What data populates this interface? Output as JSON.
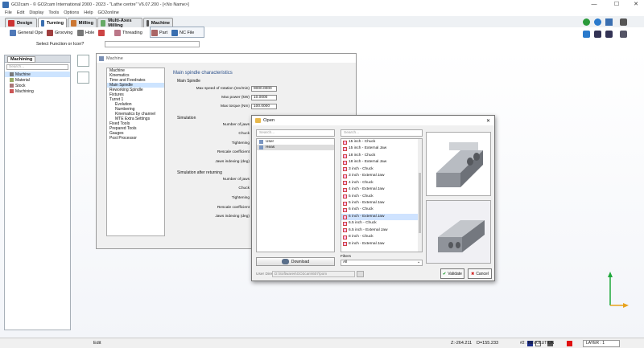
{
  "window": {
    "title": "GO2cam - © GO2cam International 2000 - 2023 - \"Lathe centre\" V6.07.200 - [<No Name>]",
    "min": "—",
    "max": "☐",
    "close": "✕"
  },
  "menu": [
    "File",
    "Edit",
    "Display",
    "Tools",
    "Options",
    "Help",
    "GO2online"
  ],
  "tabs": [
    {
      "label": "Design",
      "color": "#c33"
    },
    {
      "label": "Turning",
      "color": "#3a6fb0"
    },
    {
      "label": "Milling",
      "color": "#c73"
    },
    {
      "label": "Multi-Axes Milling",
      "color": "#6a6"
    },
    {
      "label": "Machine",
      "color": "#555"
    }
  ],
  "ribbon": {
    "general": "General Ope",
    "grooving": "Grooving",
    "hole": "Hole",
    "threading": "Threading",
    "part": "Part",
    "ncfile": "NC File"
  },
  "search_label": "Select Function or Icon?",
  "left_panel": {
    "tab": "Machining",
    "search_placeholder": "Search...",
    "items": [
      "Machine",
      "Material",
      "Stock",
      "Machining"
    ]
  },
  "machine_dialog": {
    "title": "Machine",
    "nav": [
      "Machine",
      "Kinematics",
      "Time and Feedrates",
      "Main Spindle",
      "Reworking Spindle",
      "Fixtures",
      "Turret 1",
      "Evolution",
      "Numbering",
      "Kinematics by channel",
      "MTE Extra Settings",
      "Fixed Tools",
      "Prepared Tools",
      "Gauges",
      "Post Processor"
    ],
    "heading": "Main spindle characteristics",
    "main_spindle": "Main Spindle",
    "max_speed_label": "Max speed of rotation (rev/min)",
    "max_speed": "9000.0000",
    "max_power_label": "Max power (kW)",
    "max_power": "10.0000",
    "max_torque_label": "Max torque (Nm)",
    "max_torque": "100.0000",
    "simulation": "Simulation",
    "jaws_label": "Number of jaws",
    "chuck_label": "Chuck",
    "tightening_label": "Tightening",
    "rescale_label": "Rescale coefficient",
    "jaws_indexing_label": "Jaws indexing (deg)",
    "sim_after": "Simulation after returning",
    "jaws_indexing_label2": "Jaws indexing (deg)"
  },
  "open_dialog": {
    "title": "Open",
    "close": "✕",
    "search_left": "Search...",
    "search_mid": "Search...",
    "left_items": [
      "User",
      "Heas"
    ],
    "files": [
      "15 inch - Chuck",
      "15 inch - External Jaw",
      "18 inch - Chuck",
      "18 inch - External Jaw",
      "3 inch - Chuck",
      "3 inch - External Jaw",
      "4 inch - Chuck",
      "4 inch - External Jaw",
      "5 inch - Chuck",
      "5 inch - External Jaw",
      "6 inch - Chuck",
      "6 inch - External Jaw",
      "6.5 inch - Chuck",
      "6.5 inch - External Jaw",
      "8 inch - Chuck",
      "8 inch - External Jaw"
    ],
    "selected_index": 11,
    "download": "Download",
    "filters_label": "Filters",
    "filters_value": "All",
    "user_dir_label": "User Directory",
    "user_dir_value": "D:\\Softwares\\GO2cam\\607\\pom",
    "validate": "Validate",
    "cancel": "Cancel"
  },
  "status": {
    "mode": "Edit",
    "z": "Z:-264.211",
    "d": "D=155.233",
    "revolution": "#2 : REVOLUTION",
    "layer": "LAYER : 1"
  }
}
